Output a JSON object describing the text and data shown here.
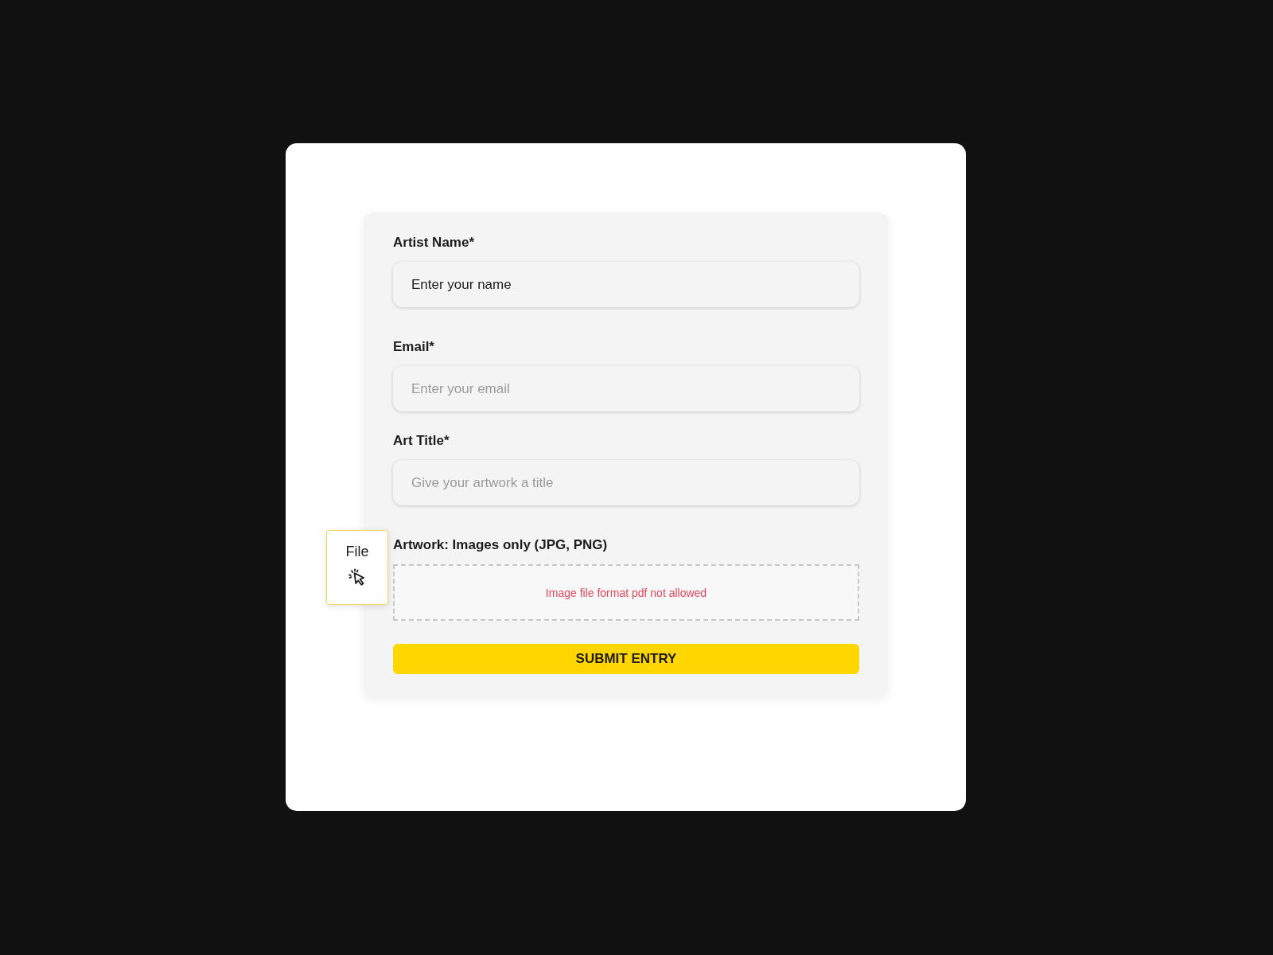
{
  "form": {
    "fields": [
      {
        "kind": "text",
        "label": "Artist Name*",
        "value": "Enter your name"
      },
      {
        "kind": "text",
        "label": "Email*",
        "placeholder": "Enter your email"
      },
      {
        "kind": "text",
        "label": "Art Title*",
        "placeholder": "Give your artwork a title"
      },
      {
        "kind": "file",
        "label": "Artwork: Images only (JPG, PNG)",
        "error": "Image file format pdf not allowed"
      }
    ],
    "file_tile": {
      "label": "File"
    },
    "submit": "SUBMIT ENTRY"
  }
}
